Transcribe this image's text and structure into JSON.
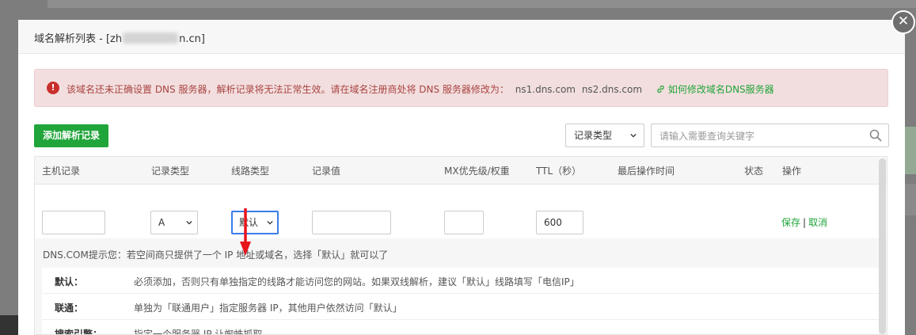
{
  "modal": {
    "title_prefix": "域名解析列表 - [zh",
    "title_suffix": "n.cn]",
    "close_glyph": "✕"
  },
  "alert": {
    "icon_glyph": "!",
    "message": "该域名还未正确设置 DNS 服务器，解析记录将无法正常生效。请在域名注册商处将 DNS 服务器修改为：",
    "ns1": "ns1.dns.com",
    "ns2": "ns2.dns.com",
    "link_label": "如何修改域名DNS服务器",
    "link_icon": "link-icon"
  },
  "toolbar": {
    "add_label": "添加解析记录",
    "type_select_value": "记录类型",
    "search_placeholder": "请输入需要查询关键字"
  },
  "table": {
    "headers": [
      "主机记录",
      "记录类型",
      "线路类型",
      "记录值",
      "MX优先级/权重",
      "TTL（秒）",
      "最后操作时间",
      "状态",
      "操作"
    ],
    "edit_row": {
      "host_value": "",
      "record_type": "A",
      "line_type": "默认",
      "record_value": "",
      "mx_value": "",
      "ttl_value": "600",
      "save_label": "保存",
      "separator": "|",
      "cancel_label": "取消"
    }
  },
  "tips": {
    "title": "DNS.COM提示您：若空间商只提供了一个 IP 地址或域名，选择「默认」就可以了",
    "rows": [
      {
        "label": "默认：",
        "text": "必须添加，否则只有单独指定的线路才能访问您的网站。如果双线解析，建议「默认」线路填写「电信IP」"
      },
      {
        "label": "联通：",
        "text": "单独为「联通用户」指定服务器 IP，其他用户依然访问「默认」"
      },
      {
        "label": "搜索引擎：",
        "text": "指定一个服务器 IP 让蜘蛛抓取"
      }
    ]
  },
  "colors": {
    "accent_green": "#20a53a",
    "alert_bg": "#f2dede",
    "alert_text": "#a94442",
    "annotation_red": "#e8141b"
  }
}
